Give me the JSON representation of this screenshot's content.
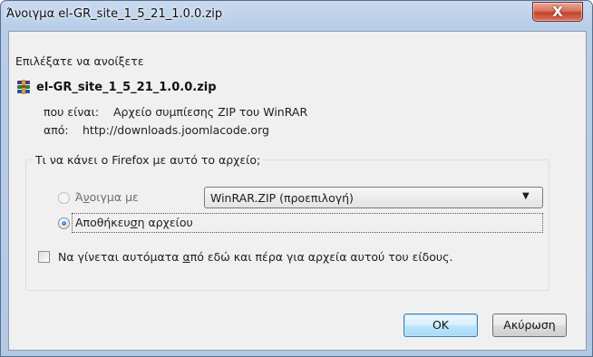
{
  "window": {
    "title": "Άνοιγμα el-GR_site_1_5_21_1.0.0.zip",
    "close_glyph": "X"
  },
  "dialog": {
    "prompt": "Επιλέξατε να ανοίξετε",
    "file_icon": "winrar-archive-icon",
    "file_name": "el-GR_site_1_5_21_1.0.0.zip",
    "type_label": "που είναι:",
    "type_value": "Αρχείο συμπίεσης ZIP του WinRAR",
    "from_label": "από:",
    "from_value": "http://downloads.joomlacode.org"
  },
  "action_group": {
    "legend": "Τι να κάνει ο Firefox  με αυτό το αρχείο;",
    "open_with": {
      "label_before": "Ά",
      "label_mnemonic": "ν",
      "label_after": "οιγμα με",
      "selected": false,
      "enabled": false,
      "app_value": "WinRAR.ZIP (προεπιλογή)"
    },
    "save_file": {
      "label_before": "Αποθήκευ",
      "label_mnemonic": "σ",
      "label_after": "η αρχείου",
      "selected": true
    },
    "auto": {
      "label_before": "Να γίνεται αυτόματα ",
      "label_mnemonic": "α",
      "label_after": "πό εδώ και πέρα για αρχεία αυτού του είδους.",
      "checked": false
    }
  },
  "buttons": {
    "ok": "OK",
    "cancel": "Ακύρωση"
  },
  "colors": {
    "titlebar": "#b8cde8",
    "client_bg": "#f0f0f0",
    "close_red": "#c3432b",
    "ok_accent": "#3c7fb1"
  }
}
